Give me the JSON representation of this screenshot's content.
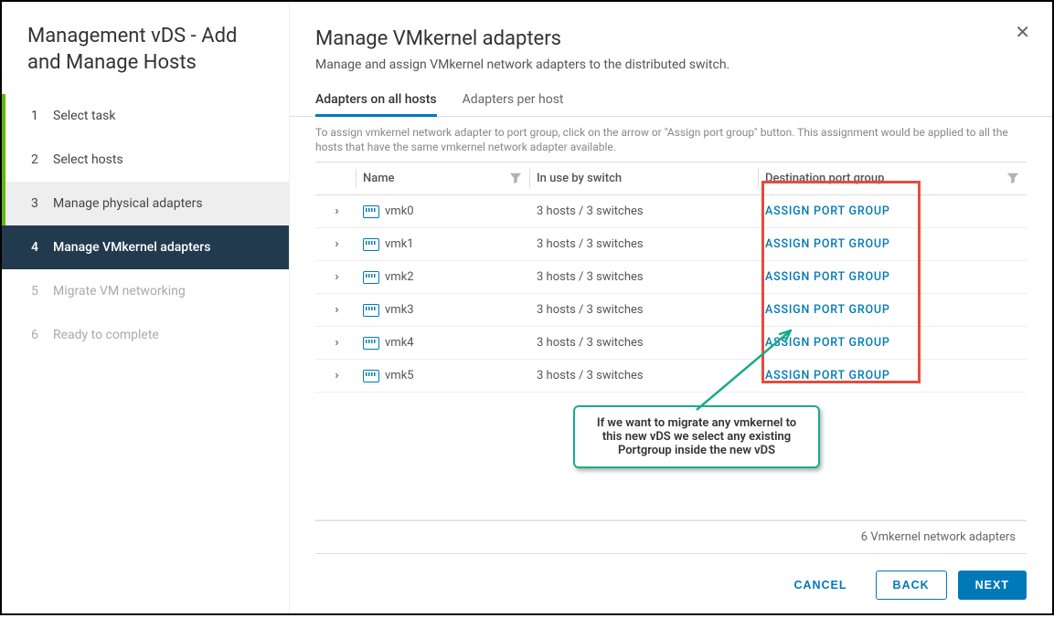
{
  "sidebar": {
    "title": "Management vDS - Add and Manage Hosts",
    "steps": [
      {
        "num": "1",
        "label": "Select task"
      },
      {
        "num": "2",
        "label": "Select hosts"
      },
      {
        "num": "3",
        "label": "Manage physical adapters"
      },
      {
        "num": "4",
        "label": "Manage VMkernel adapters"
      },
      {
        "num": "5",
        "label": "Migrate VM networking"
      },
      {
        "num": "6",
        "label": "Ready to complete"
      }
    ]
  },
  "main": {
    "title": "Manage VMkernel adapters",
    "subtitle": "Manage and assign VMkernel network adapters to the distributed switch.",
    "tabs": [
      {
        "label": "Adapters on all hosts"
      },
      {
        "label": "Adapters per host"
      }
    ],
    "instruction": "To assign vmkernel network adapter to port group, click on the arrow or \"Assign port group\" button. This assignment would be applied to all the hosts that have the same vmkernel network adapter available.",
    "columns": {
      "name": "Name",
      "switch": "In use by switch",
      "dest": "Destination port group"
    },
    "rows": [
      {
        "name": "vmk0",
        "switch": "3 hosts / 3 switches",
        "assign": "ASSIGN PORT GROUP"
      },
      {
        "name": "vmk1",
        "switch": "3 hosts / 3 switches",
        "assign": "ASSIGN PORT GROUP"
      },
      {
        "name": "vmk2",
        "switch": "3 hosts / 3 switches",
        "assign": "ASSIGN PORT GROUP"
      },
      {
        "name": "vmk3",
        "switch": "3 hosts / 3 switches",
        "assign": "ASSIGN PORT GROUP"
      },
      {
        "name": "vmk4",
        "switch": "3 hosts / 3 switches",
        "assign": "ASSIGN PORT GROUP"
      },
      {
        "name": "vmk5",
        "switch": "3 hosts / 3 switches",
        "assign": "ASSIGN PORT GROUP"
      }
    ],
    "footer_count": "6 Vmkernel network adapters",
    "callout": "If we want to migrate any vmkernel to this new vDS we select any existing Portgroup inside the new vDS",
    "buttons": {
      "cancel": "CANCEL",
      "back": "BACK",
      "next": "NEXT"
    }
  }
}
